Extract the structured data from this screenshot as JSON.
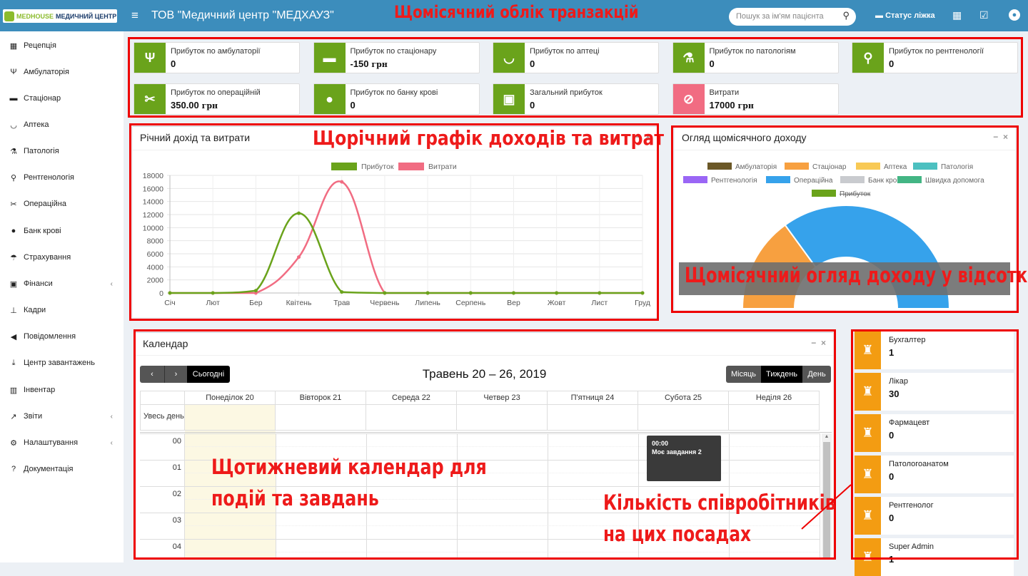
{
  "topbar": {
    "logo_text_a": "MEDHOUSE",
    "logo_text_b": "МЕДИЧНИЙ ЦЕНТР",
    "org_name": "ТОВ \"Медичний центр \"МЕДХАУЗ\"",
    "search_placeholder": "Пошук за ім'ям пацієнта",
    "bed_status": "Статус ліжка"
  },
  "annotations": {
    "transactions": "Щомісячний облік транзакцій",
    "yearly_chart": "Щорічний графік доходів та витрат",
    "monthly_overview": "Щомісячний огляд доходу у відсотках",
    "calendar_line1": "Щотижневий календар для",
    "calendar_line2": "подій та завдань",
    "staff_line1": "Кількість співробітників",
    "staff_line2": "на цих посадах"
  },
  "sidebar": {
    "items": [
      {
        "label": "Рецепція",
        "icon": "building-icon",
        "glyph": "▦"
      },
      {
        "label": "Амбулаторія",
        "icon": "stethoscope-icon",
        "glyph": "Ψ"
      },
      {
        "label": "Стаціонар",
        "icon": "bed-icon",
        "glyph": "▬"
      },
      {
        "label": "Аптека",
        "icon": "mortar-icon",
        "glyph": "◡"
      },
      {
        "label": "Патологія",
        "icon": "flask-icon",
        "glyph": "⚗"
      },
      {
        "label": "Рентгенологія",
        "icon": "microscope-icon",
        "glyph": "⚲"
      },
      {
        "label": "Операційна",
        "icon": "scissors-icon",
        "glyph": "✂"
      },
      {
        "label": "Банк крові",
        "icon": "drop-icon",
        "glyph": "●"
      },
      {
        "label": "Страхування",
        "icon": "umbrella-icon",
        "glyph": "☂"
      },
      {
        "label": "Фінанси",
        "icon": "money-icon",
        "glyph": "▣"
      },
      {
        "label": "Кадри",
        "icon": "sitemap-icon",
        "glyph": "⊥"
      },
      {
        "label": "Повідомлення",
        "icon": "bullhorn-icon",
        "glyph": "◀"
      },
      {
        "label": "Центр завантажень",
        "icon": "download-icon",
        "glyph": "⤓"
      },
      {
        "label": "Інвентар",
        "icon": "barcode-icon",
        "glyph": "▥"
      },
      {
        "label": "Звіти",
        "icon": "line-chart-icon",
        "glyph": "↗"
      },
      {
        "label": "Налаштування",
        "icon": "cogs-icon",
        "glyph": "⚙"
      },
      {
        "label": "Документація",
        "icon": "question-icon",
        "glyph": "?"
      }
    ]
  },
  "infoboxes": [
    {
      "label": "Прибуток по амбулаторії",
      "value": "0",
      "unit": "",
      "color": "#6aa31b",
      "glyph": "Ψ"
    },
    {
      "label": "Прибуток по стаціонару",
      "value": "-150",
      "unit": " грн",
      "color": "#6aa31b",
      "glyph": "▬"
    },
    {
      "label": "Прибуток по аптеці",
      "value": "0",
      "unit": "",
      "color": "#6aa31b",
      "glyph": "◡"
    },
    {
      "label": "Прибуток по патологіям",
      "value": "0",
      "unit": "",
      "color": "#6aa31b",
      "glyph": "⚗"
    },
    {
      "label": "Прибуток по рентгенології",
      "value": "0",
      "unit": "",
      "color": "#6aa31b",
      "glyph": "⚲"
    },
    {
      "label": "Прибуток по операційній",
      "value": "350.00",
      "unit": " грн",
      "color": "#6aa31b",
      "glyph": "✂"
    },
    {
      "label": "Прибуток по банку крові",
      "value": "0",
      "unit": "",
      "color": "#6aa31b",
      "glyph": "●"
    },
    {
      "label": "Загальний прибуток",
      "value": "0",
      "unit": "",
      "color": "#6aa31b",
      "glyph": "▣"
    },
    {
      "label": "Витрати",
      "value": "17000",
      "unit": " грн",
      "color": "#f16c82",
      "glyph": "⊘"
    }
  ],
  "yearly_panel": {
    "title": "Річний дохід та витрати"
  },
  "monthly_panel": {
    "title": "Огляд щомісячного доходу"
  },
  "chart_data": [
    {
      "type": "line",
      "title": "Річний дохід та витрати",
      "categories": [
        "Січ",
        "Лют",
        "Бер",
        "Квітень",
        "Трав",
        "Червень",
        "Липень",
        "Серпень",
        "Вер",
        "Жовт",
        "Лист",
        "Груд"
      ],
      "series": [
        {
          "name": "Прибуток",
          "color": "#6aa31b",
          "values": [
            0,
            0,
            350,
            12200,
            150,
            0,
            0,
            0,
            0,
            0,
            0,
            0
          ]
        },
        {
          "name": "Витрати",
          "color": "#f16c82",
          "values": [
            0,
            0,
            0,
            5500,
            17000,
            0,
            0,
            0,
            0,
            0,
            0,
            0
          ]
        }
      ],
      "ylim": [
        0,
        18000
      ],
      "yticks": [
        "18000",
        "16000",
        "14000",
        "12000",
        "10000",
        "8000",
        "6000",
        "4000",
        "2000",
        "0"
      ],
      "grid": true,
      "legend": "top"
    },
    {
      "type": "pie",
      "title": "Огляд щомісячного доходу",
      "legend": [
        {
          "name": "Амбулаторія",
          "color": "#6b5827"
        },
        {
          "name": "Стаціонар",
          "color": "#f7a040"
        },
        {
          "name": "Аптека",
          "color": "#f8c955"
        },
        {
          "name": "Патологія",
          "color": "#4cc0c0"
        },
        {
          "name": "Рентгенологія",
          "color": "#9a66f5"
        },
        {
          "name": "Операційна",
          "color": "#36a2eb"
        },
        {
          "name": "Банк крові",
          "color": "#c9cbcf"
        },
        {
          "name": "Швидка допомога",
          "color": "#43b584"
        },
        {
          "name": "Прибуток",
          "color": "#6aa31b",
          "hidden": true
        }
      ],
      "slices": [
        {
          "name": "Стаціонар",
          "fraction": 0.3,
          "color": "#f7a040"
        },
        {
          "name": "Операційна",
          "fraction": 0.7,
          "color": "#36a2eb"
        }
      ]
    }
  ],
  "calendar": {
    "title": "Календар",
    "today": "Сьогодні",
    "range": "Травень 20 – 26, 2019",
    "views": [
      "Місяць",
      "Тиждень",
      "День"
    ],
    "days": [
      "Понеділок 20",
      "Вівторок 21",
      "Середа 22",
      "Четвер 23",
      "П'ятниця 24",
      "Субота 25",
      "Неділя 26"
    ],
    "allday": "Увесь день",
    "hours": [
      "00",
      "01",
      "02",
      "03",
      "04"
    ],
    "event": {
      "time": "00:00",
      "title": "Моє завдання 2"
    }
  },
  "staff": [
    {
      "label": "Бухгалтер",
      "value": "1"
    },
    {
      "label": "Лікар",
      "value": "30"
    },
    {
      "label": "Фармацевт",
      "value": "0"
    },
    {
      "label": "Патологоанатом",
      "value": "0"
    },
    {
      "label": "Рентгенолог",
      "value": "0"
    },
    {
      "label": "Super Admin",
      "value": "1"
    }
  ]
}
